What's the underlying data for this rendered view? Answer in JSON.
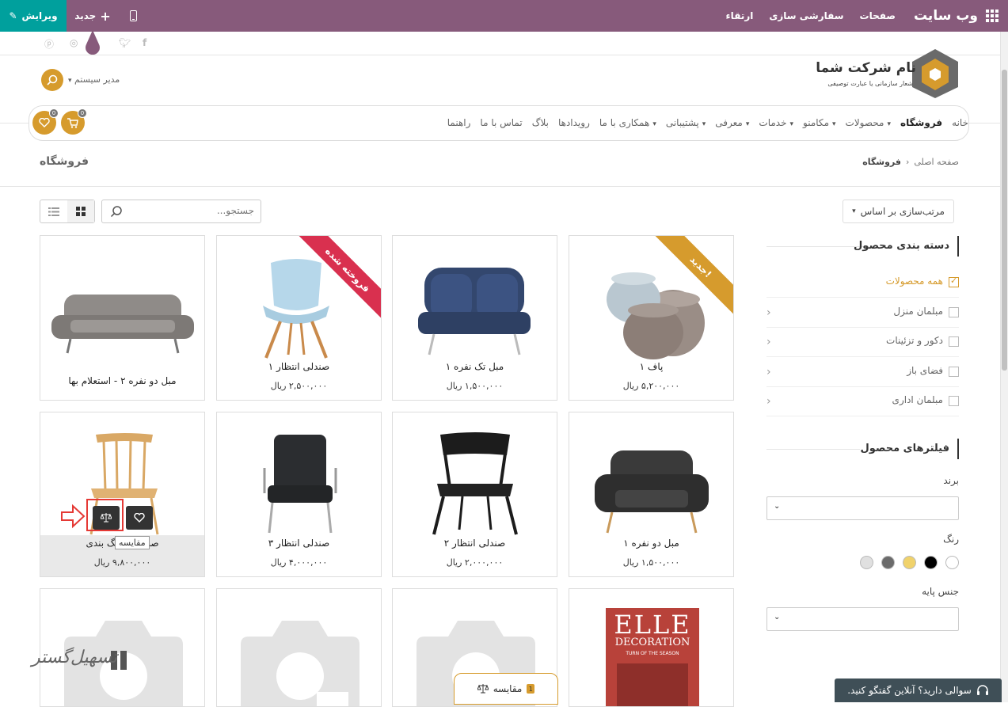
{
  "admin_bar": {
    "site_title": "وب سایت",
    "menu": [
      "صفحات",
      "سفارشی سازی",
      "ارتقاء"
    ],
    "edit_label": "ویرایش",
    "new_label": "جدید"
  },
  "header": {
    "company_name": "نام شرکت شما",
    "company_slogan": "شعار سازمانی یا عبارت توصیفی",
    "user_name": "مدیر سیستم",
    "cart_count": "0",
    "wishlist_count": "0"
  },
  "nav": {
    "items": [
      {
        "label": "خانه",
        "dropdown": false,
        "active": false
      },
      {
        "label": "فروشگاه",
        "dropdown": false,
        "active": true
      },
      {
        "label": "محصولات",
        "dropdown": true,
        "active": false
      },
      {
        "label": "مکامنو",
        "dropdown": true,
        "active": false
      },
      {
        "label": "خدمات",
        "dropdown": true,
        "active": false
      },
      {
        "label": "معرفی",
        "dropdown": true,
        "active": false
      },
      {
        "label": "پشتیبانی",
        "dropdown": true,
        "active": false
      },
      {
        "label": "همکاری با ما",
        "dropdown": true,
        "active": false
      },
      {
        "label": "رویدادها",
        "dropdown": false,
        "active": false
      },
      {
        "label": "بلاگ",
        "dropdown": false,
        "active": false
      },
      {
        "label": "تماس با ما",
        "dropdown": false,
        "active": false
      },
      {
        "label": "راهنما",
        "dropdown": false,
        "active": false
      }
    ]
  },
  "breadcrumb": {
    "home": "صفحه اصلی",
    "current": "فروشگاه"
  },
  "page_title": "فروشگاه",
  "controls": {
    "sort_label": "مرتب‌سازی بر اساس",
    "search_placeholder": "جستجو..."
  },
  "sidebar": {
    "categories_title": "دسته بندی محصول",
    "categories": [
      {
        "label": "همه محصولات",
        "checked": true
      },
      {
        "label": "مبلمان منزل",
        "checked": false
      },
      {
        "label": "دکور و تزئینات",
        "checked": false
      },
      {
        "label": "فضای باز",
        "checked": false
      },
      {
        "label": "مبلمان اداری",
        "checked": false
      }
    ],
    "filters_title": "فیلترهای محصول",
    "brand_label": "برند",
    "color_label": "رنگ",
    "colors": [
      "#ffffff",
      "#000000",
      "#f0d26b",
      "#6b6b6b",
      "#e0e0e0"
    ],
    "base_label": "جنس پایه"
  },
  "products": [
    {
      "name": "پاف ۱",
      "price": "۵,۲۰۰,۰۰۰ ریال",
      "ribbon": "جدید!",
      "ribbon_color": "#d69b2d"
    },
    {
      "name": "مبل تک نفره ۱",
      "price": "۱,۵۰۰,۰۰۰ ریال",
      "ribbon": "",
      "ribbon_color": ""
    },
    {
      "name": "صندلی انتظار ۱",
      "price": "۲,۵۰۰,۰۰۰ ریال",
      "ribbon": "فروخته شده",
      "ribbon_color": "#d9304f"
    },
    {
      "name": "مبل دو نفره ۲ - استعلام بها",
      "price": "",
      "ribbon": "",
      "ribbon_color": ""
    },
    {
      "name": "مبل دو نفره ۱",
      "price": "۱,۵۰۰,۰۰۰ ریال",
      "ribbon": "",
      "ribbon_color": ""
    },
    {
      "name": "صندلی انتظار ۲",
      "price": "۲,۰۰۰,۰۰۰ ریال",
      "ribbon": "",
      "ribbon_color": ""
    },
    {
      "name": "صندلی انتظار ۳",
      "price": "۴,۰۰۰,۰۰۰ ریال",
      "ribbon": "",
      "ribbon_color": ""
    },
    {
      "name": "صندلی - رنگ بندی",
      "price": "۹,۸۰۰,۰۰۰ ریال",
      "ribbon": "",
      "ribbon_color": ""
    }
  ],
  "magazine": {
    "title": "ELLE",
    "subtitle": "DECORATION",
    "line": "TURN OF THE SEASON"
  },
  "compare_tooltip": "مقایسه",
  "compare_bar": {
    "label": "مقایسه",
    "count": "1"
  },
  "chat": {
    "label": "سوالی دارید؟ آنلاین گفتگو کنید."
  },
  "watermark": "تسهیل‌گستر"
}
